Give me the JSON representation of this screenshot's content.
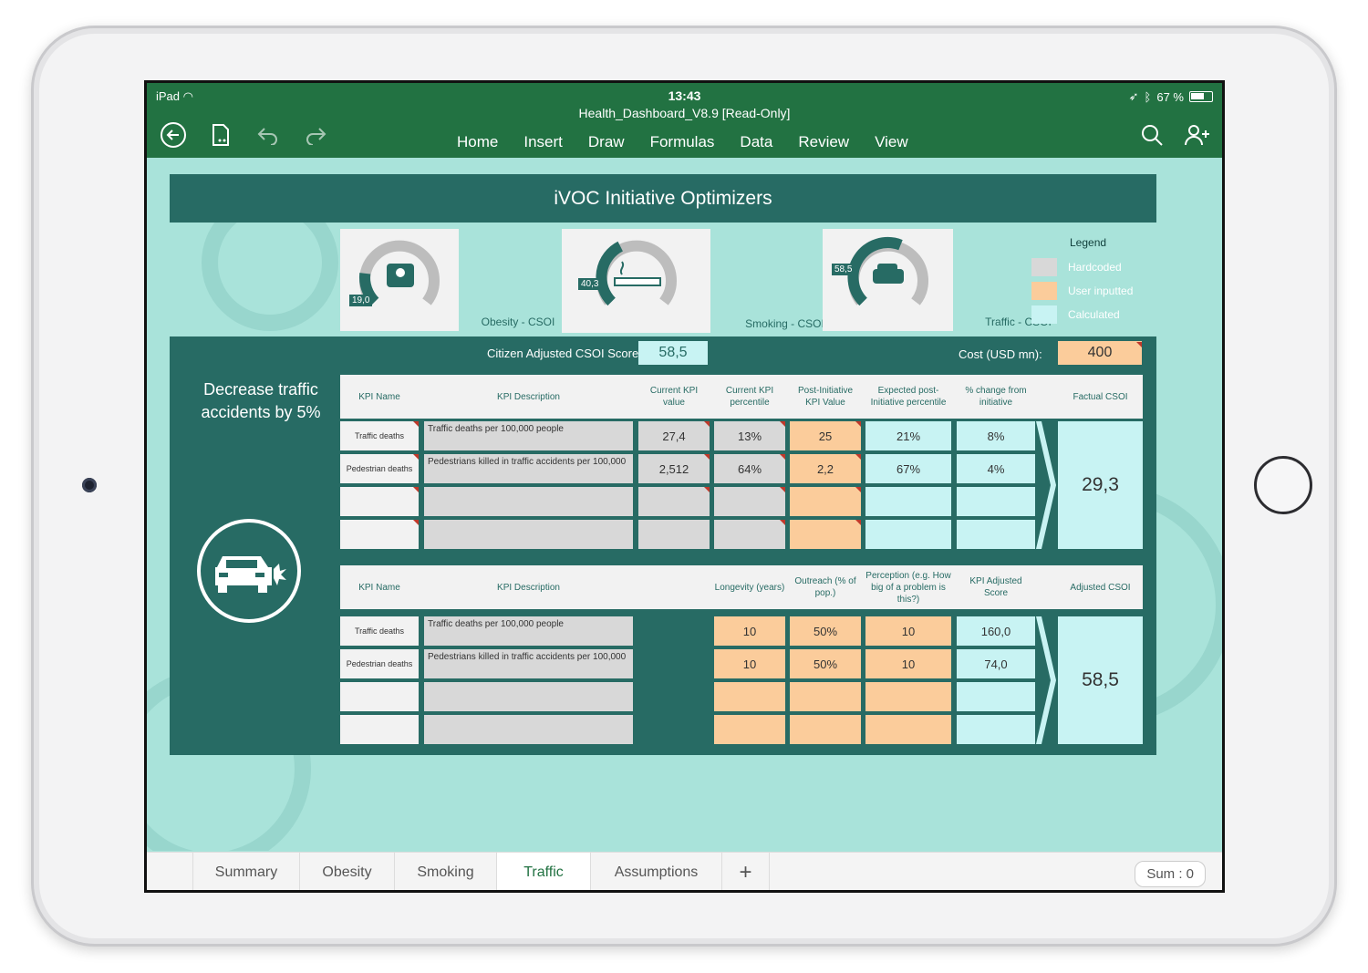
{
  "status": {
    "device": "iPad",
    "time": "13:43",
    "battery": "67 %",
    "battery_level": 0.67
  },
  "doc": {
    "title": "Health_Dashboard_V8.9 [Read-Only]"
  },
  "menu": [
    "Home",
    "Insert",
    "Draw",
    "Formulas",
    "Data",
    "Review",
    "View"
  ],
  "banner": "iVOC Initiative Optimizers",
  "gauges": [
    {
      "label": "Obesity - CSOI",
      "value": "19,0",
      "fill": 0.19
    },
    {
      "label": "Smoking - CSOI",
      "value": "40,3",
      "fill": 0.4
    },
    {
      "label": "Traffic - CSOI",
      "value": "58,5",
      "fill": 0.58
    }
  ],
  "legend": {
    "title": "Legend",
    "items": [
      {
        "label": "Hardcoded",
        "color": "#d8d8d8"
      },
      {
        "label": "User inputted",
        "color": "#fbcc9b"
      },
      {
        "label": "Calculated",
        "color": "#c8f3f3"
      }
    ]
  },
  "scores": {
    "csoi_label": "Citizen Adjusted CSOI Score:",
    "csoi_value": "58,5",
    "cost_label": "Cost (USD mn):",
    "cost_value": "400"
  },
  "goal": "Decrease traffic accidents by 5%",
  "table1": {
    "headers": [
      "KPI Name",
      "KPI Description",
      "Current KPI value",
      "Current KPI percentile",
      "Post-Initiative KPI Value",
      "Expected post-Initiative percentile",
      "% change from initiative",
      "Factual CSOI"
    ],
    "rows": [
      [
        "Traffic deaths",
        "Traffic deaths per 100,000 people",
        "27,4",
        "13%",
        "25",
        "21%",
        "8%"
      ],
      [
        "Pedestrian deaths",
        "Pedestrians killed in traffic accidents per 100,000",
        "2,512",
        "64%",
        "2,2",
        "67%",
        "4%"
      ],
      [
        "",
        "",
        "",
        "",
        "",
        "",
        ""
      ],
      [
        "",
        "",
        "",
        "",
        "",
        "",
        ""
      ]
    ],
    "result": "29,3"
  },
  "table2": {
    "headers": [
      "KPI Name",
      "KPI Description",
      "Longevity (years)",
      "Outreach (% of pop.)",
      "Perception (e.g. How big of a problem is this?)",
      "KPI Adjusted Score",
      "Adjusted CSOI"
    ],
    "rows": [
      [
        "Traffic deaths",
        "Traffic deaths per 100,000 people",
        "10",
        "50%",
        "10",
        "160,0"
      ],
      [
        "Pedestrian deaths",
        "Pedestrians killed in traffic accidents per 100,000",
        "10",
        "50%",
        "10",
        "74,0"
      ],
      [
        "",
        "",
        "",
        "",
        "",
        ""
      ],
      [
        "",
        "",
        "",
        "",
        "",
        ""
      ]
    ],
    "result": "58,5"
  },
  "tabs": [
    "Summary",
    "Obesity",
    "Smoking",
    "Traffic",
    "Assumptions"
  ],
  "add_tab": "+",
  "active_tab": "Traffic",
  "sum": "Sum : 0",
  "colors": {
    "ribbon": "#227242",
    "panel": "#276b64",
    "background": "#a9e3da"
  }
}
